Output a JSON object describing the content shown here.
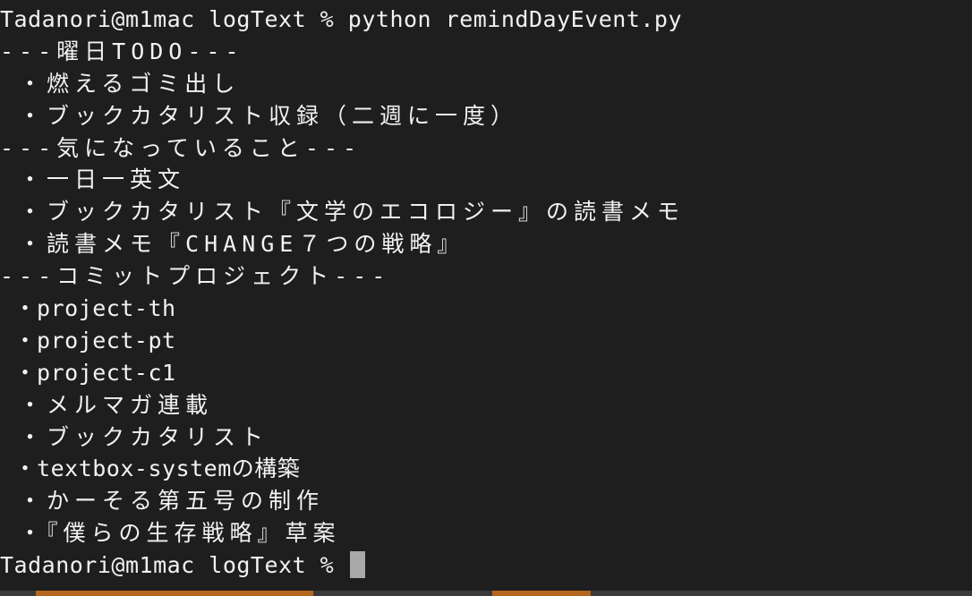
{
  "terminal": {
    "prompt": "Tadanori@m1mac logText %",
    "command": "python remindDayEvent.py",
    "final_prompt": "Tadanori@m1mac logText %",
    "output_lines": [
      "---曜日TODO---",
      " ・燃えるゴミ出し",
      " ・ブックカタリスト収録（二週に一度）",
      "---気になっていること---",
      " ・一日一英文",
      " ・ブックカタリスト『文学のエコロジー』の読書メモ",
      " ・読書メモ『CHANGE７つの戦略』",
      "---コミットプロジェクト---",
      " ・project-th",
      " ・project-pt",
      " ・project-c1",
      " ・メルマガ連載",
      " ・ブックカタリスト",
      " ・textbox-systemの構築",
      " ・かーそる第五号の制作",
      " ・『僕らの生存戦略』草案"
    ]
  },
  "colors": {
    "background": "#1e1e1e",
    "text": "#f2f2f2",
    "cursor": "#a8a8a8",
    "desktop_strip_orange": "#b5651d",
    "desktop_strip_dark": "#3a3a3a"
  }
}
